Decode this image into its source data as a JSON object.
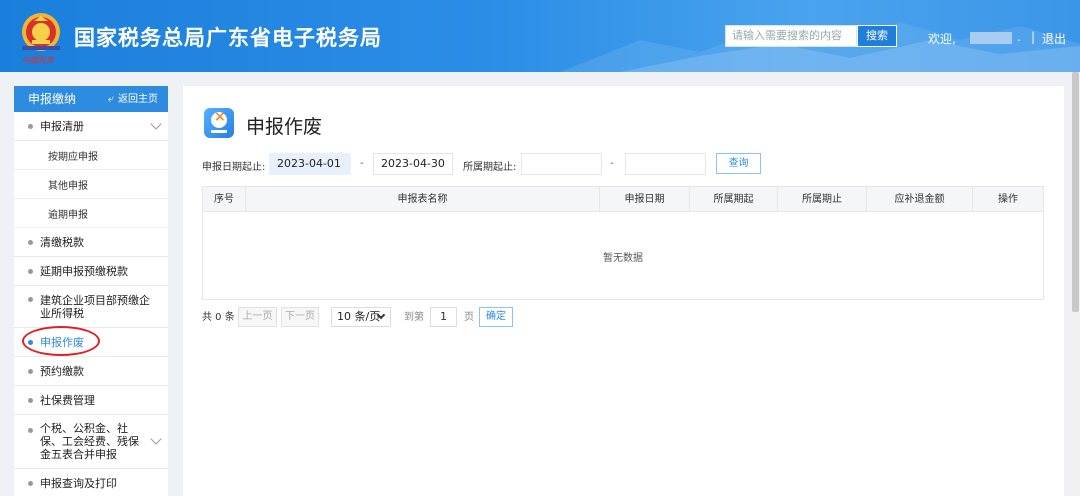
{
  "header": {
    "site_title": "国家税务总局广东省电子税务局",
    "logo_caption": "中国税务",
    "search_placeholder": "请输入需要搜索的内容",
    "search_button": "搜索",
    "welcome": "欢迎,",
    "welcome_tail": ".",
    "separator": "|",
    "logout": "退出"
  },
  "sidebar": {
    "title": "申报缴纳",
    "back_label": "返回主页",
    "items": [
      {
        "label": "申报清册",
        "type": "group",
        "expandable": true
      },
      {
        "label": "按期应申报",
        "type": "sub"
      },
      {
        "label": "其他申报",
        "type": "sub"
      },
      {
        "label": "逾期申报",
        "type": "sub"
      },
      {
        "label": "清缴税款",
        "type": "item"
      },
      {
        "label": "延期申报预缴税款",
        "type": "item"
      },
      {
        "label": "建筑企业项目部预缴企业所得税",
        "type": "item"
      },
      {
        "label": "申报作废",
        "type": "item",
        "active": true
      },
      {
        "label": "预约缴款",
        "type": "item"
      },
      {
        "label": "社保费管理",
        "type": "item"
      },
      {
        "label": "个税、公积金、社保、工会经费、残保金五表合并申报",
        "type": "item",
        "expandable": true
      },
      {
        "label": "申报查询及打印",
        "type": "item"
      }
    ]
  },
  "main": {
    "page_title": "申报作废",
    "filters": {
      "declare_date_label": "申报日期起止:",
      "declare_date_start": "2023-04-01",
      "declare_date_end": "2023-04-30",
      "period_label": "所属期起止:",
      "period_start": "",
      "period_end": "",
      "dash": "-",
      "query_button": "查询"
    },
    "table": {
      "columns": [
        "序号",
        "申报表名称",
        "申报日期",
        "所属期起",
        "所属期止",
        "应补退金额",
        "操作"
      ],
      "rows": [],
      "empty_text": "暂无数据"
    },
    "pagination": {
      "total": "共 0 条",
      "prev": "上一页",
      "next": "下一页",
      "page_size": "10 条/页",
      "goto_label": "到第",
      "page_value": "1",
      "page_unit": "页",
      "confirm": "确定"
    }
  },
  "colors": {
    "primary": "#2d8be0",
    "header_bg": "#1a7fdc",
    "highlight_circle": "#e02020"
  }
}
